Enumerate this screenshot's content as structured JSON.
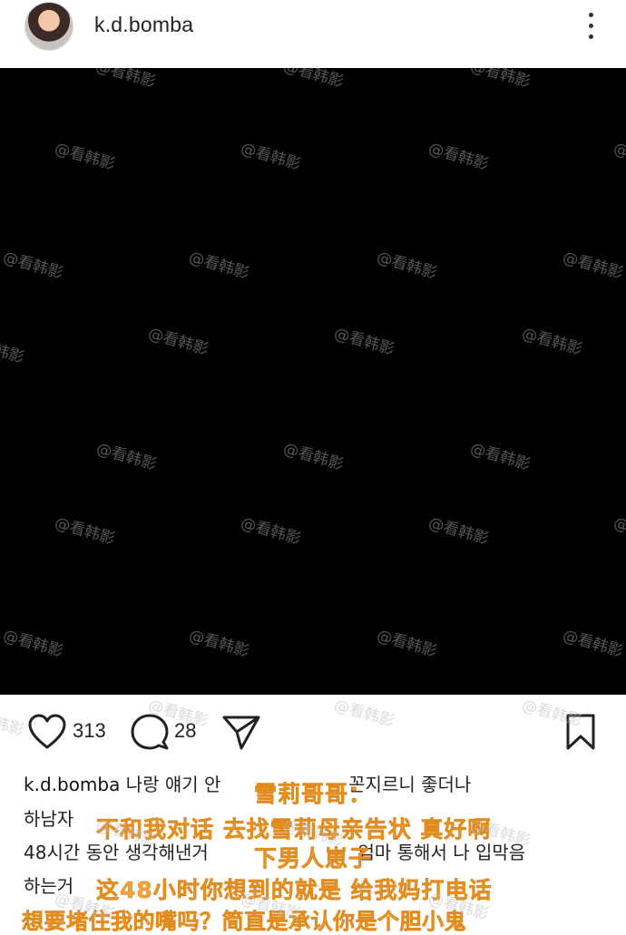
{
  "header": {
    "username": "k.d.bomba",
    "avatar_icon": "avatar-photo",
    "menu_icon": "more-vertical-icon"
  },
  "watermark": "@看韩影",
  "actions": {
    "like_icon": "heart-icon",
    "like_count": "313",
    "comment_icon": "comment-icon",
    "comment_count": "28",
    "share_icon": "send-icon",
    "save_icon": "bookmark-icon"
  },
  "caption": {
    "username": "k.d.bomba",
    "line1_a": "나랑 얘기 안",
    "line1_b": "꼰지르니 좋더나",
    "line2": "하남자",
    "line3_a": "48시간 동안 생각해낸거",
    "line3_b": "엄마 통해서 나 입막음",
    "line4": "하는거",
    "line5": "."
  },
  "overlay": {
    "line1": "雪莉哥哥：",
    "line2": "不和我对话 去找雪莉母亲告状 真好啊",
    "line3": "下男人崽子",
    "line4": "这48小时你想到的就是 给我妈打电话",
    "line5": "想要堵住我的嘴吗？简直是承认你是个胆小鬼"
  },
  "colors": {
    "overlay_text": "#f2a33a",
    "post_background": "#000000",
    "page_background": "#ffffff"
  }
}
